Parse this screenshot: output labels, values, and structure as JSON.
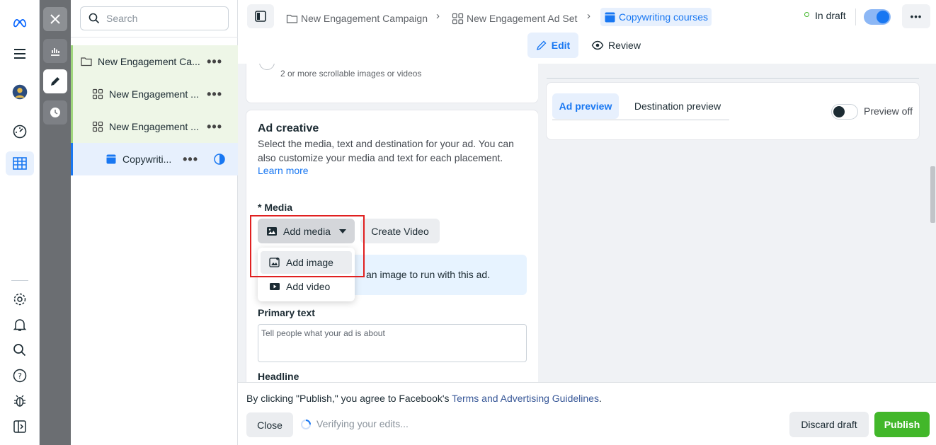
{
  "search": {
    "placeholder": "Search"
  },
  "tree": {
    "items": [
      {
        "label": "New Engagement Ca..."
      },
      {
        "label": "New Engagement ..."
      },
      {
        "label": "New Engagement ..."
      },
      {
        "label": "Copywriti..."
      }
    ]
  },
  "breadcrumb": {
    "campaign": "New Engagement Campaign",
    "adset": "New Engagement Ad Set",
    "ad": "Copywriting courses"
  },
  "status": {
    "label": "In draft"
  },
  "modes": {
    "edit": "Edit",
    "review": "Review"
  },
  "format_card": {
    "carousel_desc": "2 or more scrollable images or videos"
  },
  "ad_creative": {
    "title": "Ad creative",
    "desc": "Select the media, text and destination for your ad. You can also customize your media and text for each placement.",
    "learn_more": "Learn more",
    "media_label": "* Media",
    "add_media": "Add media",
    "create_video": "Create Video",
    "info_text": "an image to run with this ad.",
    "menu": {
      "add_image": "Add image",
      "add_video": "Add video"
    },
    "primary_text_label": "Primary text",
    "primary_text_placeholder": "Tell people what your ad is about",
    "headline_label": "Headline"
  },
  "preview": {
    "tab_ad": "Ad preview",
    "tab_dest": "Destination preview",
    "toggle_label": "Preview off"
  },
  "footer": {
    "disclaimer_prefix": "By clicking \"Publish,\" you agree to Facebook's ",
    "disclaimer_link": "Terms and Advertising Guidelines",
    "disclaimer_suffix": ".",
    "close": "Close",
    "verifying": "Verifying your edits...",
    "discard": "Discard draft",
    "publish": "Publish"
  },
  "colors": {
    "accent": "#1877f2",
    "publish": "#42b72a",
    "highlight_box": "#e02020"
  }
}
